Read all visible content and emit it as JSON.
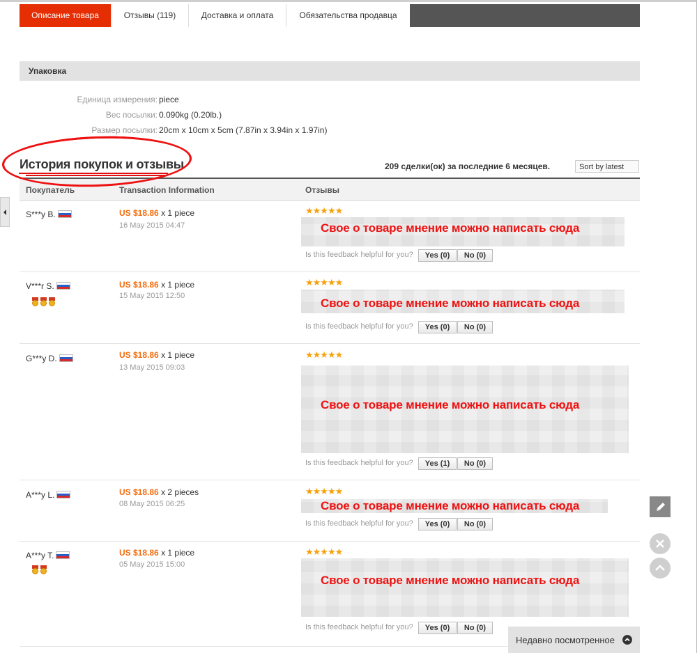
{
  "tabs": [
    {
      "label": "Описание товара",
      "active": true
    },
    {
      "label": "Отзывы (119)",
      "active": false
    },
    {
      "label": "Доставка и оплата",
      "active": false
    },
    {
      "label": "Обязательства продавца",
      "active": false
    }
  ],
  "packaging": {
    "section_title": "Упаковка",
    "specs": [
      {
        "label": "Единица измерения:",
        "value": "piece"
      },
      {
        "label": "Вес посылки:",
        "value": "0.090kg (0.20lb.)"
      },
      {
        "label": "Размер посылки:",
        "value": "20cm x 10cm x 5cm (7.87in x 3.94in x 1.97in)"
      }
    ]
  },
  "history": {
    "title": "История покупок и отзывы",
    "deals_text": "209 сделки(ок) за последние 6 месяцев.",
    "sort_label": "Sort by latest",
    "columns": [
      "Покупатель",
      "Transaction Information",
      "Отзывы"
    ]
  },
  "reviews": [
    {
      "buyer": "S***y B.",
      "medals": 0,
      "price": "US $18.86",
      "qty": "x 1 piece",
      "date": "16 May 2015 04:47",
      "stars": "★★★★★",
      "note": "Свое  о товаре мнение можно написать сюда",
      "helpful": "Is this feedback helpful for you?",
      "yes": "Yes (0)",
      "no": "No (0)"
    },
    {
      "buyer": "V***r S.",
      "medals": 3,
      "price": "US $18.86",
      "qty": "x 1 piece",
      "date": "15 May 2015 12:50",
      "stars": "★★★★★",
      "note": "Свое  о товаре мнение можно написать сюда",
      "helpful": "Is this feedback helpful for you?",
      "yes": "Yes (0)",
      "no": "No (0)"
    },
    {
      "buyer": "G***y D.",
      "medals": 0,
      "price": "US $18.86",
      "qty": "x 1 piece",
      "date": "13 May 2015 09:03",
      "stars": "★★★★★",
      "note": "Свое  о товаре мнение можно написать сюда",
      "helpful": "Is this feedback helpful for you?",
      "yes": "Yes (1)",
      "no": "No (0)"
    },
    {
      "buyer": "A***y L.",
      "medals": 0,
      "price": "US $18.86",
      "qty": "x 2 pieces",
      "date": "08 May 2015 06:25",
      "stars": "★★★★★",
      "note": "Свое  о товаре мнение можно написать сюда",
      "helpful": "Is this feedback helpful for you?",
      "yes": "Yes (0)",
      "no": "No (0)"
    },
    {
      "buyer": "A***y T.",
      "medals": 2,
      "price": "US $18.86",
      "qty": "x 1 piece",
      "date": "05 May 2015 15:00",
      "stars": "★★★★★",
      "note": "Свое  о товаре мнение можно написать сюда",
      "helpful": "Is this feedback helpful for you?",
      "yes": "Yes (0)",
      "no": "No (0)"
    }
  ],
  "recently_viewed": "Недавно посмотренное",
  "icons": {
    "pencil": "pencil-icon",
    "close": "close-icon",
    "up": "chevron-up-icon",
    "sort": "arrow-down-icon"
  },
  "colors": {
    "accent": "#e62e04",
    "price": "#f56d0e",
    "stars": "#f6a10b",
    "annotation": "#ee1111"
  }
}
